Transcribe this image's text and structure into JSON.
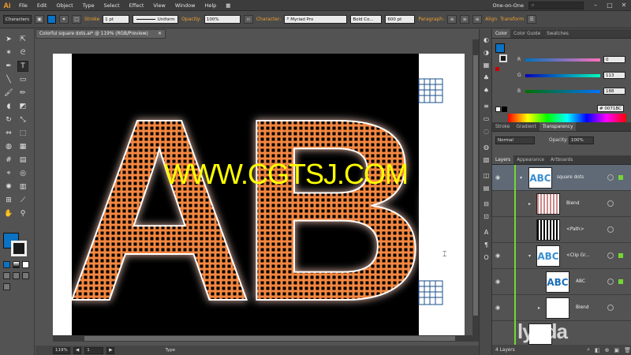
{
  "app": {
    "logo": "Ai",
    "menus": [
      "File",
      "Edit",
      "Object",
      "Type",
      "Select",
      "Effect",
      "View",
      "Window",
      "Help"
    ],
    "workspace": "One-on-One",
    "window_buttons": [
      "–",
      "□",
      "✕"
    ]
  },
  "control_bar": {
    "characters_label": "Characters",
    "stroke_label": "Stroke",
    "stroke_value": "1 pt",
    "stroke_profile": "Uniform",
    "opacity_label": "Opacity:",
    "opacity_value": "100%",
    "font_name": "Myriad Pro",
    "font_style": "Bold Co...",
    "font_size": "600 pt",
    "paragraph_label": "Paragraph:",
    "align_label": "Align",
    "transform_label": "Transform",
    "fill_color": "#0b72c4"
  },
  "document": {
    "tab_title": "Colorful square dots.ai* @ 119% (RGB/Preview)",
    "close_icon": "close-icon"
  },
  "canvas": {
    "letters": "ABC",
    "dot_color": "#f5873f",
    "watermark": "WWW.CGTSJ.COM",
    "watermark_color": "#ffff00"
  },
  "status_bar": {
    "zoom": "119%",
    "page": "1",
    "mode": "Type"
  },
  "color_panel": {
    "tabs": [
      "Color",
      "Color Guide",
      "Swatches"
    ],
    "active_tab": "Color",
    "rows": [
      {
        "label": "R",
        "value": "0"
      },
      {
        "label": "G",
        "value": "113"
      },
      {
        "label": "B",
        "value": "188"
      }
    ],
    "hex": "0071BC",
    "fill": "#0071bc"
  },
  "transparency_panel": {
    "tabs": [
      "Stroke",
      "Gradient",
      "Transparency"
    ],
    "active_tab": "Transparency",
    "blend_mode": "Normal",
    "opacity_label": "Opacity:",
    "opacity_value": "100%"
  },
  "layers_panel": {
    "tabs": [
      "Layers",
      "Appearance",
      "Artboards"
    ],
    "active_tab": "Layers",
    "rows": [
      {
        "name": "square dots",
        "thumb": "ABC"
      },
      {
        "name": "Blend",
        "thumb": ""
      },
      {
        "name": "<Path>",
        "thumb": ""
      },
      {
        "name": "<Clip Gr...",
        "thumb": "ABC"
      },
      {
        "name": "ABC",
        "thumb": "ABC"
      },
      {
        "name": "Blend",
        "thumb": ""
      }
    ],
    "count": "4 Layers"
  },
  "watermark_logo": "lynda"
}
